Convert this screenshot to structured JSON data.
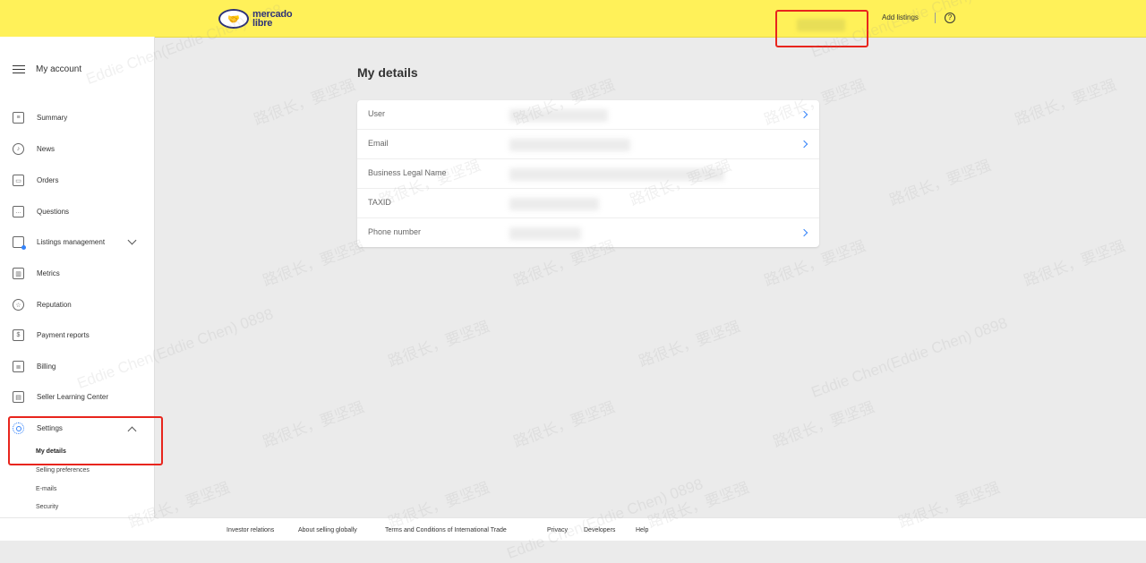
{
  "header": {
    "logo_line1": "mercado",
    "logo_line2": "libre",
    "add_listings": "Add listings",
    "help_glyph": "?",
    "colors": {
      "bar": "#fff159",
      "highlight": "#e8251d",
      "accent": "#3483fa"
    }
  },
  "sidebar": {
    "title": "My account",
    "items": [
      {
        "label": "Summary",
        "icon": "summary-icon"
      },
      {
        "label": "News",
        "icon": "bell-icon"
      },
      {
        "label": "Orders",
        "icon": "orders-icon"
      },
      {
        "label": "Questions",
        "icon": "chat-icon"
      },
      {
        "label": "Listings management",
        "icon": "listings-icon"
      },
      {
        "label": "Metrics",
        "icon": "metrics-icon"
      },
      {
        "label": "Reputation",
        "icon": "reputation-icon"
      },
      {
        "label": "Payment reports",
        "icon": "payment-icon"
      },
      {
        "label": "Billing",
        "icon": "billing-icon"
      },
      {
        "label": "Seller Learning Center",
        "icon": "learning-icon"
      },
      {
        "label": "Settings",
        "icon": "settings-icon"
      }
    ],
    "settings_sub": [
      {
        "label": "My details",
        "active": true
      },
      {
        "label": "Selling preferences"
      },
      {
        "label": "E-mails"
      },
      {
        "label": "Security"
      }
    ]
  },
  "main": {
    "title": "My details",
    "rows": [
      {
        "label": "User"
      },
      {
        "label": "Email"
      },
      {
        "label": "Business Legal Name"
      },
      {
        "label": "TAXID"
      },
      {
        "label": "Phone number"
      }
    ]
  },
  "footer": {
    "links": [
      "Investor relations",
      "About selling globally",
      "Terms and Conditions of International Trade",
      "Privacy",
      "Developers",
      "Help"
    ]
  },
  "watermark": {
    "text_en": "Eddie Chen(Eddie Chen) 0898",
    "text_cn": "路很长，要坚强"
  }
}
